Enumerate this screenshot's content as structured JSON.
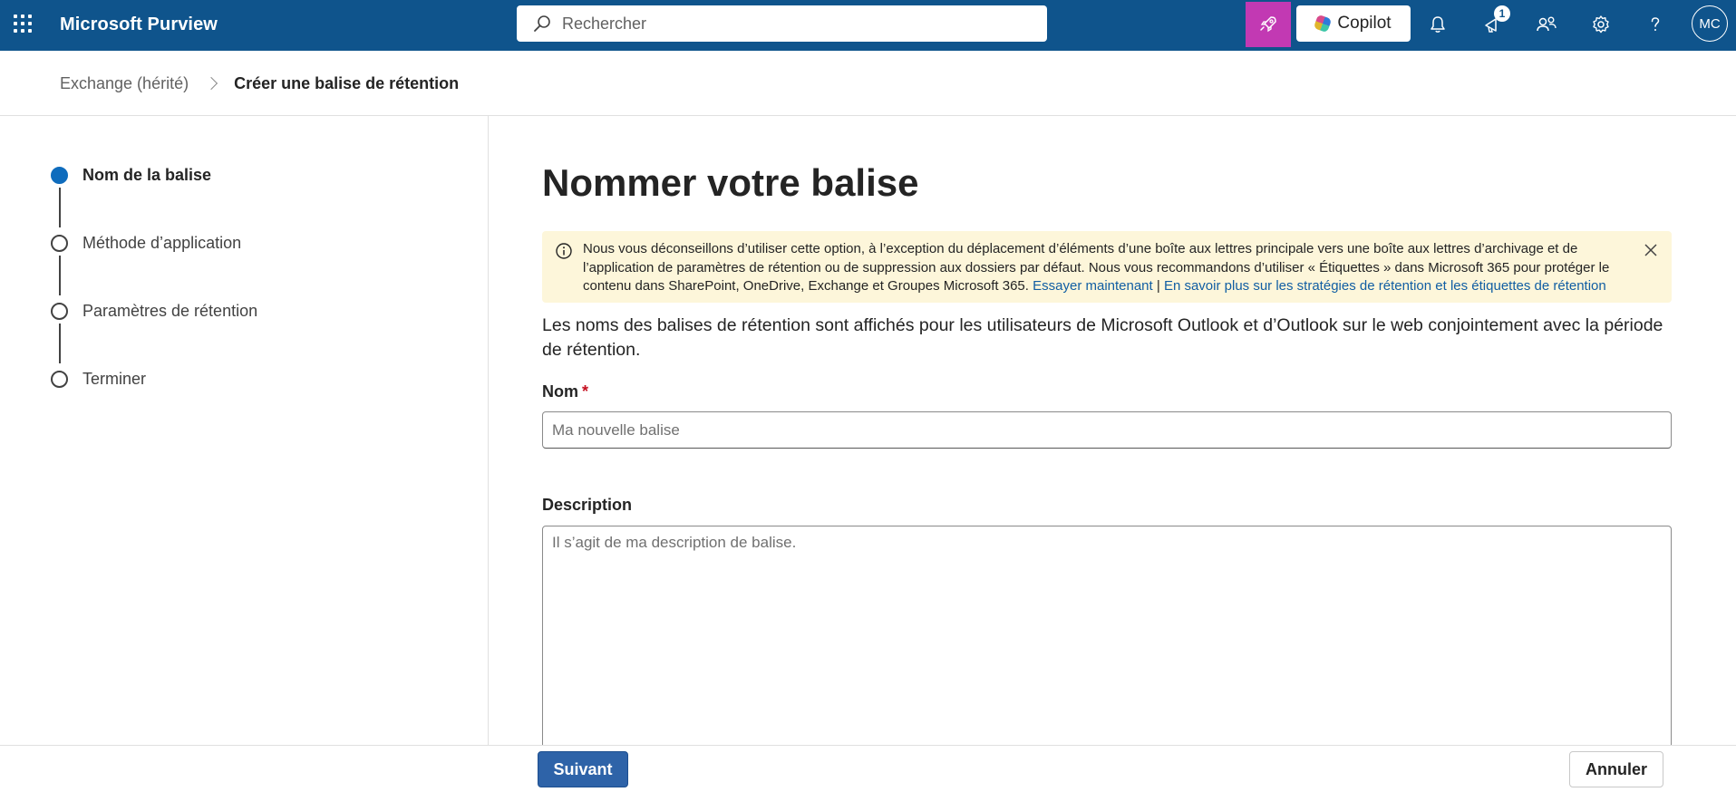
{
  "topbar": {
    "app_title": "Microsoft Purview",
    "search_placeholder": "Rechercher",
    "copilot_label": "Copilot",
    "notification_badge": "1",
    "avatar_initials": "MC",
    "icons": [
      "app-launcher-icon",
      "search-icon",
      "rocket-icon",
      "copilot-icon",
      "bell-icon",
      "announcement-icon",
      "people-icon",
      "gear-icon",
      "help-icon"
    ],
    "colors": {
      "bar": "#0f548c",
      "rocket_button": "#c239b3"
    }
  },
  "breadcrumb": {
    "parent": "Exchange (hérité)",
    "current": "Créer une balise de rétention"
  },
  "wizard": {
    "steps": [
      {
        "label": "Nom de la balise",
        "active": true
      },
      {
        "label": "Méthode d’application",
        "active": false
      },
      {
        "label": "Paramètres de rétention",
        "active": false
      },
      {
        "label": "Terminer",
        "active": false
      }
    ]
  },
  "main": {
    "title": "Nommer votre balise",
    "banner": {
      "text": "Nous vous déconseillons d’utiliser cette option, à l’exception du déplacement d’éléments d’une boîte aux lettres principale vers une boîte aux lettres d’archivage et de l’application de paramètres de rétention ou de suppression aux dossiers par défaut. Nous vous recommandons d’utiliser « Étiquettes » dans Microsoft 365 pour protéger le contenu dans SharePoint, OneDrive, Exchange et Groupes Microsoft 365.",
      "link1": "Essayer maintenant",
      "separator": "|",
      "link2": "En savoir plus sur les stratégies de rétention et les étiquettes de rétention"
    },
    "intro": "Les noms des balises de rétention sont affichés pour les utilisateurs de Microsoft Outlook et d’Outlook sur le web conjointement avec la période de rétention.",
    "name_label": "Nom",
    "required_mark": "*",
    "name_placeholder": "Ma nouvelle balise",
    "name_value": "",
    "description_label": "Description",
    "description_placeholder": "Il s’agit de ma description de balise.",
    "description_value": ""
  },
  "footer": {
    "next_label": "Suivant",
    "cancel_label": "Annuler"
  }
}
